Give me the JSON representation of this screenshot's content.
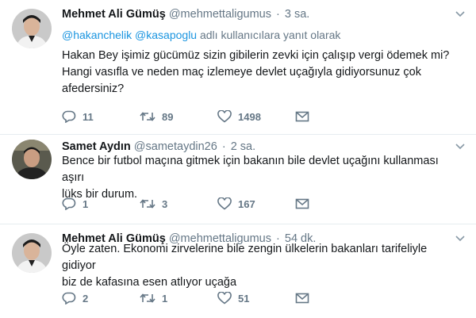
{
  "tweets": [
    {
      "name": "Mehmet Ali Gümüş",
      "handle": "@mehmettaligumus",
      "sep": "·",
      "time": "3 sa.",
      "reply_to": {
        "mention1": "@hakanchelik",
        "mention2": "@kasapoglu",
        "suffix": "adlı kullanıcılara yanıt olarak"
      },
      "text_lines": [
        "Hakan Bey işimiz gücümüz sizin gibilerin zevki için çalışıp vergi ödemek mi?",
        "Hangi vasıfla ve neden maç izlemeye devlet uçağıyla gidiyorsunuz çok",
        "afedersiniz?"
      ],
      "replies": "11",
      "retweets": "89",
      "likes": "1498"
    },
    {
      "name": "Samet Aydın",
      "handle": "@sametaydin26",
      "sep": "·",
      "time": "2 sa.",
      "text_lines": [
        "Bence bir futbol maçına gitmek için bakanın bile devlet uçağını kullanması aşırı",
        "lüks bir durum."
      ],
      "replies": "1",
      "retweets": "3",
      "likes": "167"
    },
    {
      "name": "Mehmet Ali Gümüş",
      "handle": "@mehmettaligumus",
      "sep": "·",
      "time": "54 dk.",
      "text_lines": [
        "Öyle zaten. Ekonomi zirvelerine bile zengin ülkelerin bakanları tarifeliyle gidiyor",
        "biz de kafasına esen atlıyor uçağa"
      ],
      "replies": "2",
      "retweets": "1",
      "likes": "51"
    }
  ],
  "icons": {
    "reply": "reply-icon",
    "retweet": "retweet-icon",
    "like": "heart-icon",
    "message": "envelope-icon",
    "more": "chevron-down-icon"
  },
  "colors": {
    "link": "#1b95e0",
    "secondary": "#657786",
    "text": "#14171a",
    "divider": "#e6ecf0"
  }
}
